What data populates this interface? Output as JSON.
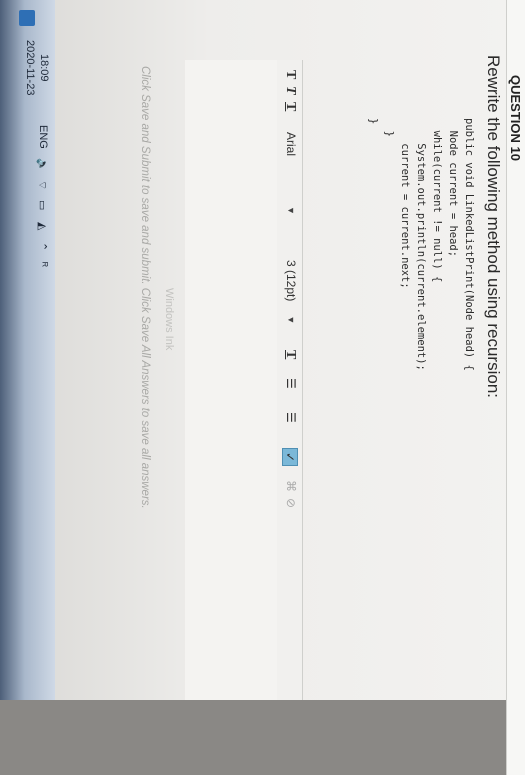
{
  "question": {
    "header": "QUESTION 10",
    "prompt": "Rewrite the following method using recursion:"
  },
  "code": {
    "lines": [
      "public void LinkedListPrint(Node head) {",
      "  Node current = head;",
      "  while(current != null) {",
      "    System.out.println(current.element);",
      "    current = current.next;",
      "  }",
      "}"
    ]
  },
  "toolbar": {
    "bold_label": "T",
    "italic_label": "T",
    "underline_label": "T",
    "font_family": "Arial",
    "font_size": "3 (12pt)",
    "text_color_label": "T",
    "bullet_list_label": "☰",
    "numbered_list_label": "☰",
    "spellcheck_label": "✓"
  },
  "editor": {
    "watermark": "Windows Ink",
    "instructions": "Click Save and Submit to save and submit. Click Save All Answers to save all answers."
  },
  "taskbar": {
    "time": "18:09",
    "date": "2020-11-23",
    "language": "ENG"
  }
}
